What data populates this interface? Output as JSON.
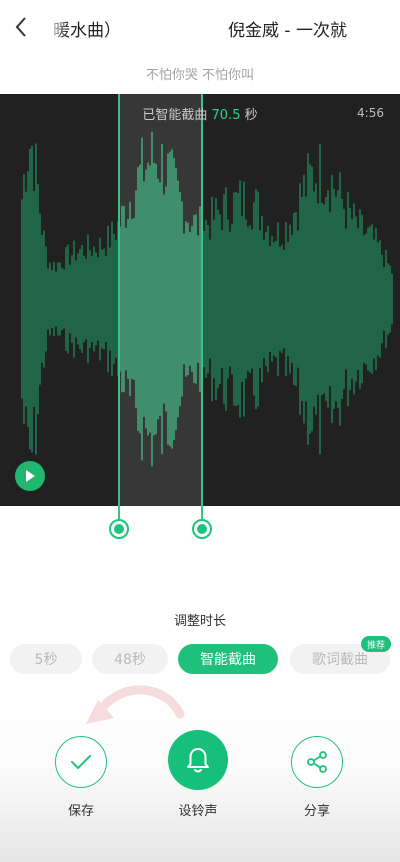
{
  "header": {
    "title_part1": "》暖水曲）",
    "title_part2": "倪金威 - 一次就"
  },
  "lyric": "不怕你哭  不怕你叫",
  "waveform": {
    "smart_label": "已智能截曲",
    "smart_value": "70.5",
    "smart_unit": "秒",
    "duration": "4:56"
  },
  "adjust": {
    "label": "调整时长",
    "options": [
      "5秒",
      "48秒",
      "智能截曲",
      "歌词截曲"
    ],
    "selected": "智能截曲",
    "badge": "推荐"
  },
  "actions": {
    "save": "保存",
    "set_ringtone": "设铃声",
    "share": "分享"
  },
  "colors": {
    "accent": "#1ec47c",
    "wave_bg": "#212121"
  }
}
